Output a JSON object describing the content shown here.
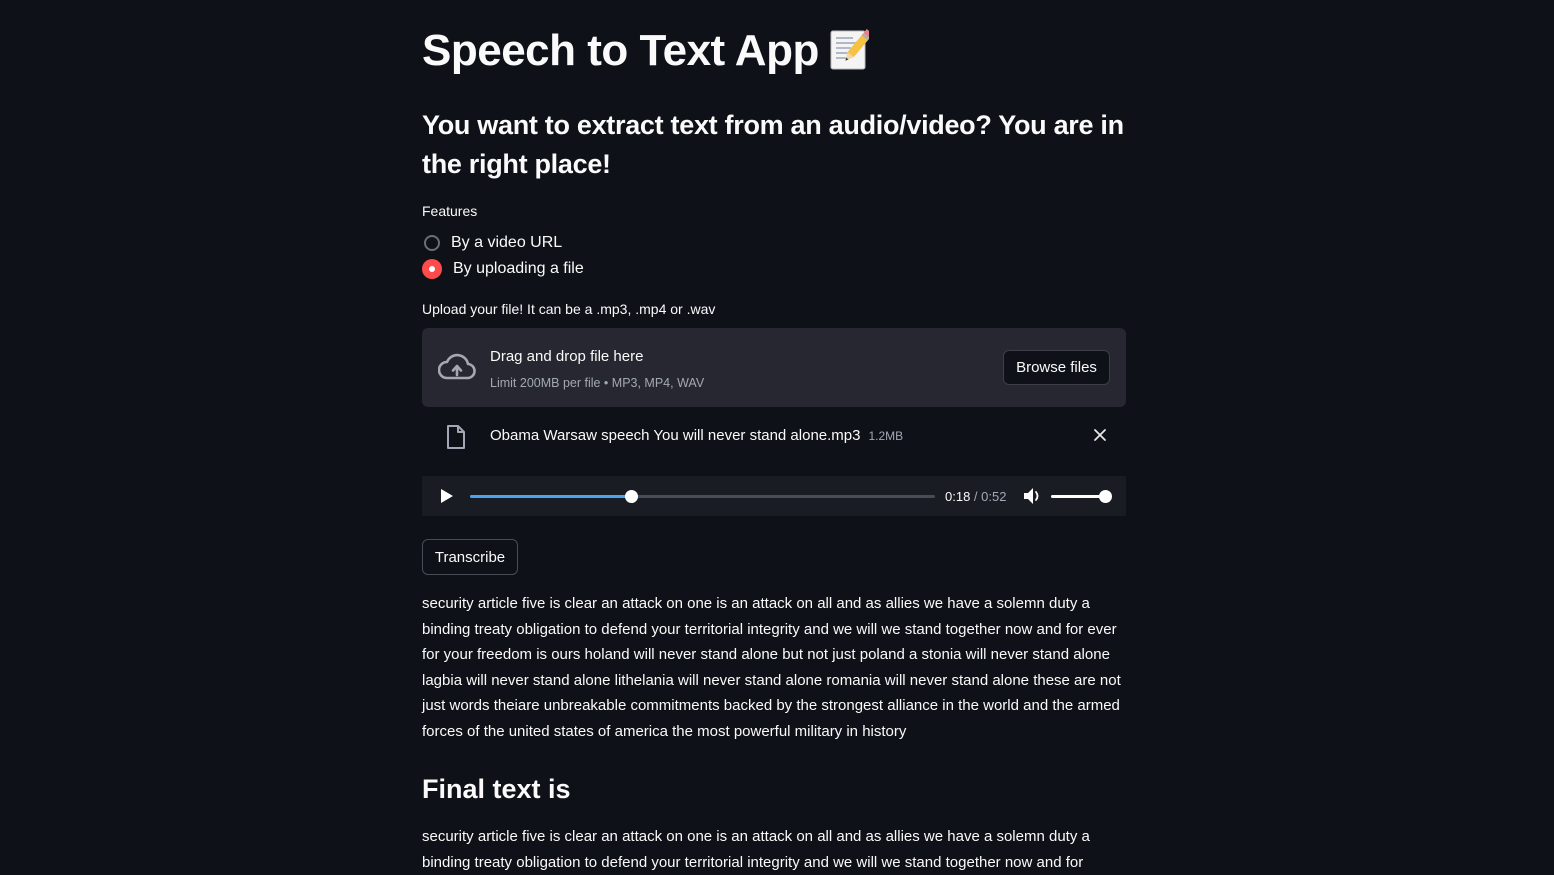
{
  "app": {
    "title": "Speech to Text App",
    "title_icon": "memo-icon",
    "subtitle": "You want to extract text from an audio/video? You are in the right place!"
  },
  "features": {
    "label": "Features",
    "options": [
      {
        "label": "By a video URL",
        "selected": false
      },
      {
        "label": "By uploading a file",
        "selected": true
      }
    ]
  },
  "uploader": {
    "label": "Upload your file! It can be a .mp3, .mp4 or .wav",
    "drag_text": "Drag and drop file here",
    "limit_text": "Limit 200MB per file • MP3, MP4, WAV",
    "browse_label": "Browse files",
    "icon": "cloud-upload-icon"
  },
  "uploaded_file": {
    "name": "Obama Warsaw speech You will never stand alone.mp3",
    "size": "1.2MB",
    "icon": "file-icon"
  },
  "audio_player": {
    "current_time": "0:18",
    "separator": " / ",
    "duration": "0:52",
    "progress": 0.346,
    "volume": 1.0
  },
  "actions": {
    "transcribe_label": "Transcribe"
  },
  "transcript": {
    "text": "security article five is clear an attack on one is an attack on all and as allies we have a solemn duty a binding treaty obligation to defend your territorial integrity and we will we stand together now and for ever for your freedom is ours holand will never stand alone but not just poland a stonia will never stand alone lagbia will never stand alone lithelania will never stand alone romania will never stand alone these are not just words theiare unbreakable commitments backed by the strongest alliance in the world and the armed forces of the united states of america the most powerful military in history"
  },
  "final": {
    "heading": "Final text is",
    "text": "security article five is clear an attack on one is an attack on all and as allies we have a solemn duty a binding treaty obligation to defend your territorial integrity and we will we stand together now and for"
  },
  "colors": {
    "background": "#0e1117",
    "accent": "#ff4b4b",
    "progress": "#4aa3f0",
    "panel": "#262730"
  }
}
